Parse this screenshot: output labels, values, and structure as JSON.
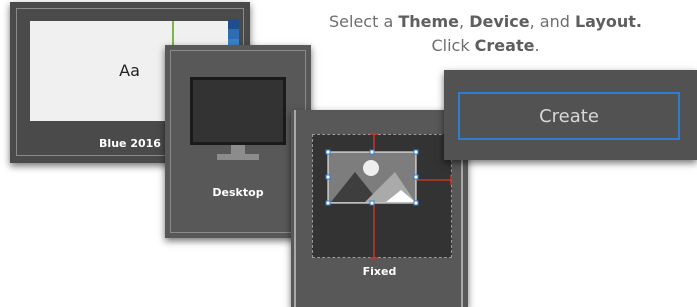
{
  "instructions": {
    "line1_prefix": "Select a ",
    "theme_word": "Theme",
    "sep1": ", ",
    "device_word": "Device",
    "sep2": ", and ",
    "layout_word": "Layout.",
    "line2_prefix": "Click ",
    "create_word": "Create",
    "line2_suffix": "."
  },
  "theme_card": {
    "preview_text": "Aa",
    "label": "Blue 2016",
    "swatches": [
      "#1f4e8c",
      "#2f6db3",
      "#3b82c9",
      "#5d9bd5"
    ],
    "accent_color": "#7ab648"
  },
  "device_card": {
    "label": "Desktop",
    "icon": "monitor-icon"
  },
  "layout_card": {
    "label": "Fixed",
    "icon": "image-icon",
    "guide_color": "#c0392b"
  },
  "create_panel": {
    "button_label": "Create",
    "border_color": "#2f7cd3"
  }
}
